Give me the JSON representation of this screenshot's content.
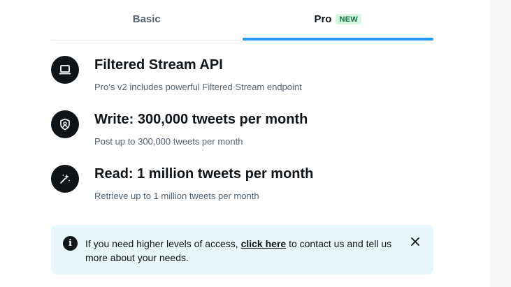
{
  "tabs": [
    {
      "label": "Basic",
      "active": false
    },
    {
      "label": "Pro",
      "active": true,
      "badge": "NEW"
    }
  ],
  "accent_color": "#1d9bf0",
  "features": [
    {
      "icon": "laptop-icon",
      "title": "Filtered Stream API",
      "description": "Pro’s v2 includes powerful Filtered Stream endpoint"
    },
    {
      "icon": "shield-person-icon",
      "title": "Write: 300,000 tweets per month",
      "description": "Post up to 300,000 tweets per month"
    },
    {
      "icon": "sparkle-wand-icon",
      "title": "Read: 1 million tweets per month",
      "description": "Retrieve up to 1 million tweets per month"
    }
  ],
  "banner": {
    "icon": "info-icon",
    "text_before": "If you need higher levels of access, ",
    "link_text": "click here",
    "text_after": " to contact us and tell us more about your needs.",
    "close_icon": "close-icon"
  }
}
